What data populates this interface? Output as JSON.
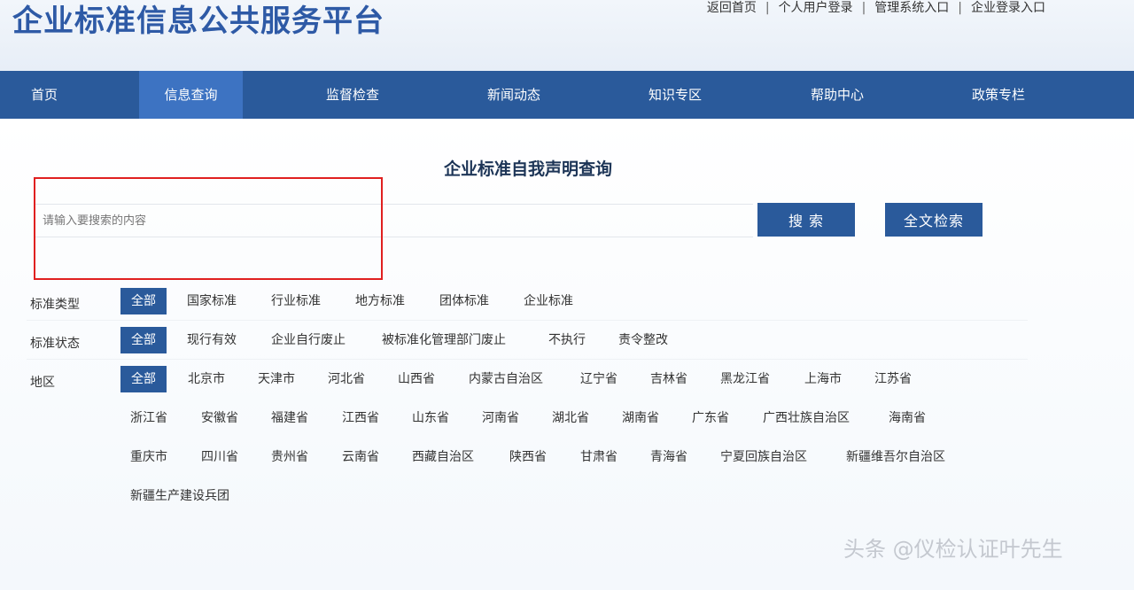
{
  "header": {
    "site_title": "企业标准信息公共服务平台",
    "top_links": [
      "返回首页",
      "个人用户登录",
      "管理系统入口",
      "企业登录入口"
    ],
    "separator": "|"
  },
  "nav": {
    "items": [
      "首页",
      "信息查询",
      "监督检查",
      "新闻动态",
      "知识专区",
      "帮助中心",
      "政策专栏"
    ],
    "active": "信息查询"
  },
  "search": {
    "title": "企业标准自我声明查询",
    "placeholder": "请输入要搜索的内容",
    "search_button": "搜 索",
    "fulltext_button": "全文检索"
  },
  "filters": {
    "standard_type": {
      "label": "标准类型",
      "options": [
        "全部",
        "国家标准",
        "行业标准",
        "地方标准",
        "团体标准",
        "企业标准"
      ]
    },
    "standard_status": {
      "label": "标准状态",
      "options": [
        "全部",
        "现行有效",
        "企业自行废止",
        "被标准化管理部门废止",
        "不执行",
        "责令整改"
      ]
    },
    "region": {
      "label": "地区",
      "all": "全部",
      "rows": [
        [
          "北京市",
          "天津市",
          "河北省",
          "山西省",
          "内蒙古自治区",
          "辽宁省",
          "吉林省",
          "黑龙江省",
          "上海市",
          "江苏省"
        ],
        [
          "浙江省",
          "安徽省",
          "福建省",
          "江西省",
          "山东省",
          "河南省",
          "湖北省",
          "湖南省",
          "广东省",
          "广西壮族自治区",
          "海南省"
        ],
        [
          "重庆市",
          "四川省",
          "贵州省",
          "云南省",
          "西藏自治区",
          "陕西省",
          "甘肃省",
          "青海省",
          "宁夏回族自治区",
          "新疆维吾尔自治区"
        ],
        [
          "新疆生产建设兵团"
        ]
      ]
    }
  },
  "watermark": "头条 @仪检认证叶先生",
  "colors": {
    "nav_bg": "#2a5a9b",
    "nav_active_bg": "#3d73c2",
    "title_blue": "#2e5aa6",
    "highlight_red": "#e02020"
  }
}
